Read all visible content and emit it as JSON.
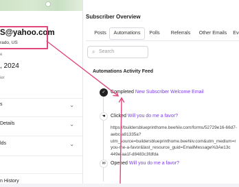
{
  "left_panel": {
    "email": "S@yahoo.com",
    "location": "rado, US",
    "label_e": "e",
    "date": ", 2024",
    "label_ier": "ier",
    "sections": [
      {
        "label": "s"
      },
      {
        "label": "Details"
      },
      {
        "label": "lds"
      },
      {
        "label": "n History"
      }
    ]
  },
  "subscriber_overview": {
    "title": "Subscriber Overview",
    "tabs": [
      "Posts",
      "Automations",
      "Polls",
      "Referrals",
      "Other Emails",
      "Events"
    ],
    "active_tab": "Automations",
    "search_placeholder": "Search",
    "feed_title": "Automations Activity Feed",
    "events": [
      {
        "prefix": "Completed",
        "link": "New Subscriber Welcome Email",
        "icon": "check-circle-icon"
      },
      {
        "prefix": "Clicked",
        "link": "Will you do me a favor?",
        "icon": "cursor-click-icon"
      },
      {
        "prefix": "Opened",
        "link": "Will you do me a favor?",
        "icon": "envelope-open-icon"
      }
    ],
    "url_lines": [
      "https://buildersblueprinthome.beehiiv.com/forms/52729e16-66d7-",
      "aebc-a81335a?",
      "utm_source=buildersblueprinthome.beehiiv.com&utm_medium=r",
      "you-me-a-favor&last_resource_guid=EmailMessage%3Ae13c",
      "449e-aa1f-d8483c3fdfda"
    ]
  },
  "annotation_color": "#e0467c",
  "link_color": "#7b3fe4"
}
